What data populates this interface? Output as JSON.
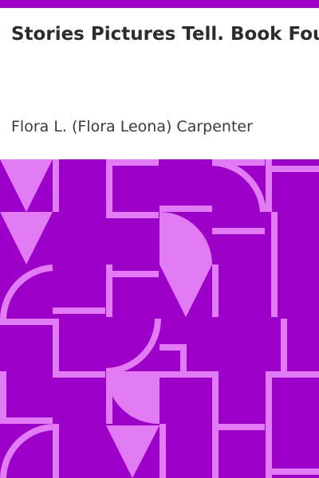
{
  "book": {
    "title": "Stories Pictures Tell. Book Four",
    "author": "Flora L. (Flora Leona) Carpenter"
  },
  "colors": {
    "accent": "#9c00c8",
    "pattern_light": "#e17cf5",
    "title_text": "#2c2c2c",
    "author_text": "#3a3a3a",
    "background": "#ffffff"
  }
}
